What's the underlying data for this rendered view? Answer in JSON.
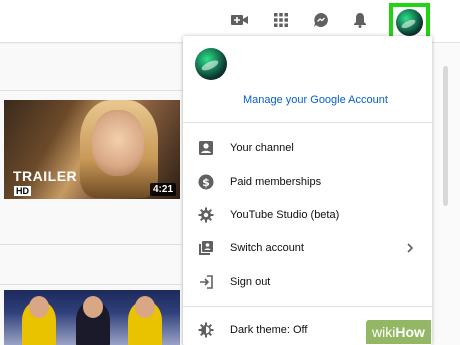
{
  "menu": {
    "manage_account": "Manage your Google Account",
    "items": [
      {
        "label": "Your channel",
        "icon": "account-box-icon"
      },
      {
        "label": "Paid memberships",
        "icon": "dollar-icon"
      },
      {
        "label": "YouTube Studio (beta)",
        "icon": "gear-icon"
      },
      {
        "label": "Switch account",
        "icon": "switch-account-icon",
        "has_submenu": true
      },
      {
        "label": "Sign out",
        "icon": "sign-out-icon"
      },
      {
        "label": "Dark theme: Off",
        "icon": "dark-theme-icon"
      }
    ]
  },
  "header": {
    "icons": [
      "create-video-icon",
      "apps-icon",
      "messages-icon",
      "notifications-icon",
      "avatar"
    ]
  },
  "videos": [
    {
      "overlay_title": "TRAILER",
      "overlay_badge": "HD",
      "duration": "4:21"
    }
  ],
  "watermark": {
    "part1": "wiki",
    "part2": "How"
  },
  "colors": {
    "highlight": "#21d412",
    "link": "#065fd4",
    "watermark_bg": "#93b764"
  }
}
